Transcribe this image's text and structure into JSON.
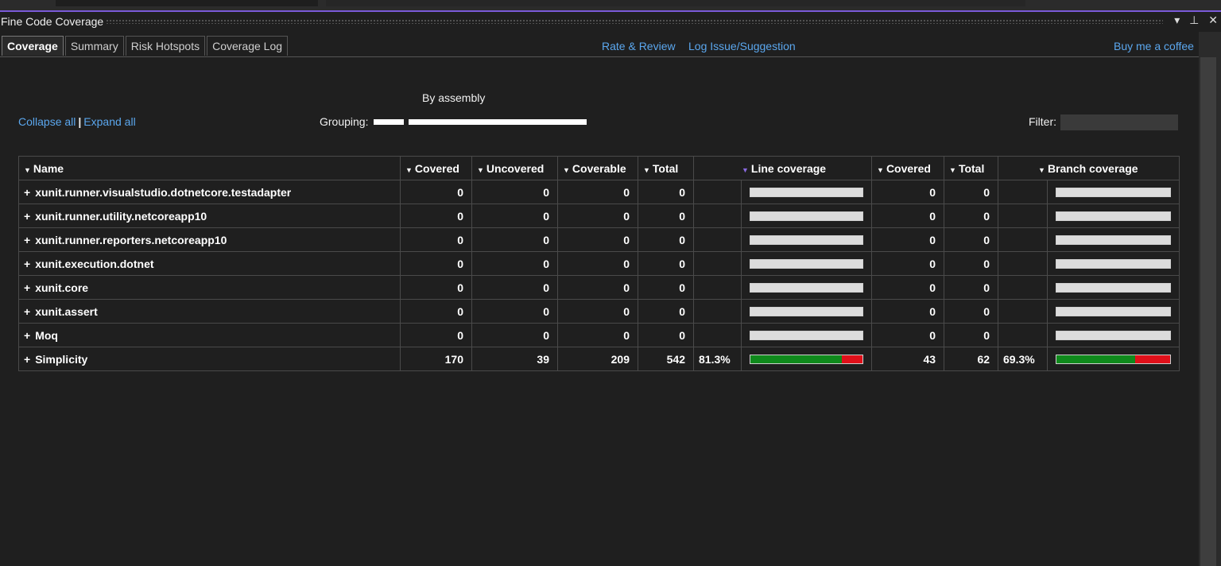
{
  "window": {
    "title": "Fine Code Coverage",
    "controls": [
      "▾",
      "⊥",
      "✕"
    ]
  },
  "tabs": [
    {
      "label": "Coverage",
      "active": true
    },
    {
      "label": "Summary"
    },
    {
      "label": "Risk Hotspots"
    },
    {
      "label": "Coverage Log"
    }
  ],
  "links": {
    "rate": "Rate & Review",
    "log_issue": "Log Issue/Suggestion",
    "buy_coffee": "Buy me a coffee"
  },
  "toolbar": {
    "collapse_all": "Collapse all",
    "separator": "|",
    "expand_all": "Expand all",
    "grouping_value": "By assembly",
    "grouping_label": "Grouping:",
    "filter_label": "Filter:",
    "filter_value": ""
  },
  "table": {
    "headers": {
      "name": "Name",
      "covered": "Covered",
      "uncovered": "Uncovered",
      "coverable": "Coverable",
      "total": "Total",
      "line_coverage": "Line coverage",
      "branch_covered": "Covered",
      "branch_total": "Total",
      "branch_coverage": "Branch coverage"
    },
    "rows": [
      {
        "name": "xunit.runner.visualstudio.dotnetcore.testadapter",
        "covered": "0",
        "uncovered": "0",
        "coverable": "0",
        "total": "0",
        "line_pct": "",
        "line_fraction": null,
        "b_covered": "0",
        "b_total": "0",
        "branch_pct": "",
        "branch_fraction": null
      },
      {
        "name": "xunit.runner.utility.netcoreapp10",
        "covered": "0",
        "uncovered": "0",
        "coverable": "0",
        "total": "0",
        "line_pct": "",
        "line_fraction": null,
        "b_covered": "0",
        "b_total": "0",
        "branch_pct": "",
        "branch_fraction": null
      },
      {
        "name": "xunit.runner.reporters.netcoreapp10",
        "covered": "0",
        "uncovered": "0",
        "coverable": "0",
        "total": "0",
        "line_pct": "",
        "line_fraction": null,
        "b_covered": "0",
        "b_total": "0",
        "branch_pct": "",
        "branch_fraction": null
      },
      {
        "name": "xunit.execution.dotnet",
        "covered": "0",
        "uncovered": "0",
        "coverable": "0",
        "total": "0",
        "line_pct": "",
        "line_fraction": null,
        "b_covered": "0",
        "b_total": "0",
        "branch_pct": "",
        "branch_fraction": null
      },
      {
        "name": "xunit.core",
        "covered": "0",
        "uncovered": "0",
        "coverable": "0",
        "total": "0",
        "line_pct": "",
        "line_fraction": null,
        "b_covered": "0",
        "b_total": "0",
        "branch_pct": "",
        "branch_fraction": null
      },
      {
        "name": "xunit.assert",
        "covered": "0",
        "uncovered": "0",
        "coverable": "0",
        "total": "0",
        "line_pct": "",
        "line_fraction": null,
        "b_covered": "0",
        "b_total": "0",
        "branch_pct": "",
        "branch_fraction": null
      },
      {
        "name": "Moq",
        "covered": "0",
        "uncovered": "0",
        "coverable": "0",
        "total": "0",
        "line_pct": "",
        "line_fraction": null,
        "b_covered": "0",
        "b_total": "0",
        "branch_pct": "",
        "branch_fraction": null
      },
      {
        "name": "Simplicity",
        "covered": "170",
        "uncovered": "39",
        "coverable": "209",
        "total": "542",
        "line_pct": "81.3%",
        "line_fraction": 0.813,
        "b_covered": "43",
        "b_total": "62",
        "branch_pct": "69.3%",
        "branch_fraction": 0.693
      }
    ]
  },
  "colors": {
    "accent": "#7a5ad8",
    "link": "#5ba7ee",
    "covered_bar": "#0f8a1c",
    "uncovered_bar": "#e0101a",
    "empty_bar": "#dcdcdc"
  }
}
